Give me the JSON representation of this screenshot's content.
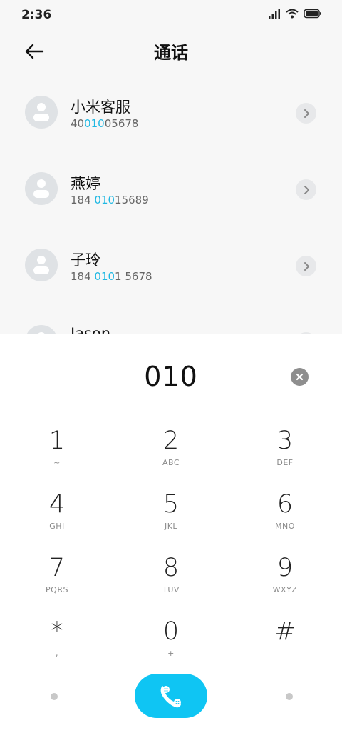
{
  "status_bar": {
    "time": "2:36"
  },
  "header": {
    "title": "通话"
  },
  "contacts": [
    {
      "name": "小米客服",
      "number_parts": [
        "40",
        "010",
        "05678"
      ]
    },
    {
      "name": "燕婷",
      "number_parts": [
        "184 ",
        "010",
        "15689"
      ]
    },
    {
      "name": "子玲",
      "number_parts": [
        "184 ",
        "010",
        "1 5678"
      ]
    },
    {
      "name": "Jason",
      "number_parts": [
        "",
        "",
        ""
      ]
    }
  ],
  "dialpad": {
    "display": "010",
    "keys": [
      {
        "digit": "1",
        "letters": "~"
      },
      {
        "digit": "2",
        "letters": "ABC"
      },
      {
        "digit": "3",
        "letters": "DEF"
      },
      {
        "digit": "4",
        "letters": "GHI"
      },
      {
        "digit": "5",
        "letters": "JKL"
      },
      {
        "digit": "6",
        "letters": "MNO"
      },
      {
        "digit": "7",
        "letters": "PQRS"
      },
      {
        "digit": "8",
        "letters": "TUV"
      },
      {
        "digit": "9",
        "letters": "WXYZ"
      },
      {
        "digit": "*",
        "letters": ","
      },
      {
        "digit": "0",
        "letters": "+"
      },
      {
        "digit": "#",
        "letters": ""
      }
    ]
  },
  "colors": {
    "accent": "#0fc5f3",
    "highlight": "#1fb8e3"
  },
  "icons": {
    "back": "arrow-left-icon",
    "detail": "chevron-right-icon",
    "clear": "clear-icon",
    "call": "phone-icon"
  }
}
